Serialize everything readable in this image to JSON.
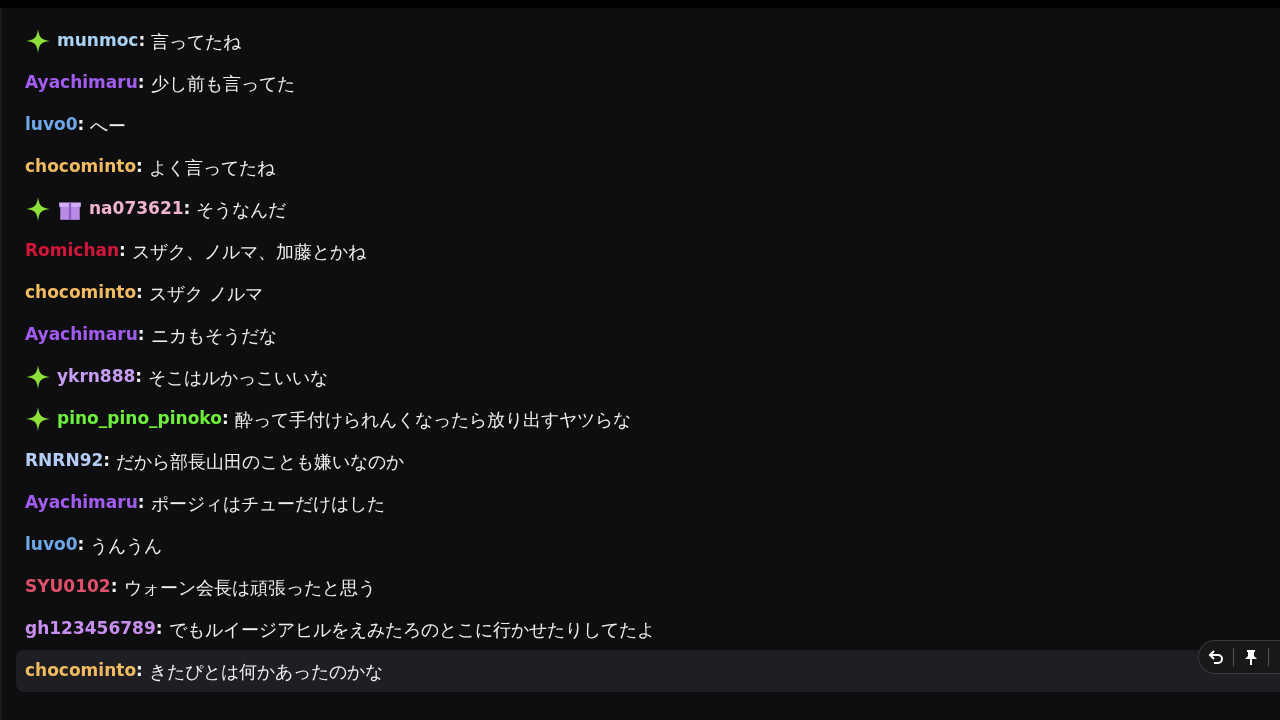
{
  "messages": [
    {
      "user": "munmoc",
      "separator": ":",
      "color": "#a9d2f5",
      "badges": [
        {
          "kind": "sparkle"
        }
      ],
      "text": "言ってたね",
      "hovered": false
    },
    {
      "user": "Ayachimaru",
      "separator": ":",
      "color": "#a25cf0",
      "text": "少し前も言ってた",
      "hovered": false
    },
    {
      "user": "luvo0",
      "separator": ":",
      "color": "#6fa8e8",
      "text": "へー",
      "hovered": false
    },
    {
      "user": "chocominto",
      "separator": ":",
      "color": "#f1bb62",
      "text": "よく言ってたね",
      "hovered": false
    },
    {
      "user": "na073621",
      "separator": ":",
      "color": "#f0b4cf",
      "badges": [
        {
          "kind": "sparkle"
        },
        {
          "kind": "gift"
        }
      ],
      "text": "そうなんだ",
      "hovered": false
    },
    {
      "user": "Romichan",
      "separator": ":",
      "color": "#d2153a",
      "text": "スザク、ノルマ、加藤とかね",
      "hovered": false
    },
    {
      "user": "chocominto",
      "separator": ":",
      "color": "#f1bb62",
      "text": "スザク ノルマ",
      "hovered": false
    },
    {
      "user": "Ayachimaru",
      "separator": ":",
      "color": "#a25cf0",
      "text": "ニカもそうだな",
      "hovered": false
    },
    {
      "user": "ykrn888",
      "separator": ":",
      "color": "#c69df2",
      "badges": [
        {
          "kind": "sparkle"
        }
      ],
      "text": "そこはルかっこいいな",
      "hovered": false
    },
    {
      "user": "pino_pino_pinoko",
      "separator": ":",
      "color": "#6df03c",
      "badges": [
        {
          "kind": "sparkle"
        }
      ],
      "text": "酔って手付けられんくなったら放り出すヤツらな",
      "hovered": false
    },
    {
      "user": "RNRN92",
      "separator": ":",
      "color": "#b5cdf5",
      "text": "だから部長山田のことも嫌いなのか",
      "hovered": false
    },
    {
      "user": "Ayachimaru",
      "separator": ":",
      "color": "#a25cf0",
      "text": "ポージィはチューだけはした",
      "hovered": false
    },
    {
      "user": "luvo0",
      "separator": ":",
      "color": "#6fa8e8",
      "text": "うんうん",
      "hovered": false
    },
    {
      "user": "SYU0102",
      "separator": ":",
      "color": "#e0506b",
      "text": "ウォーン会長は頑張ったと思う",
      "hovered": false
    },
    {
      "user": "gh123456789",
      "separator": ":",
      "color": "#c98ff0",
      "text": "でもルイージアヒルをえみたろのとこに行かせたりしてたよ",
      "hovered": false
    },
    {
      "user": "chocominto",
      "separator": ":",
      "color": "#f1bb62",
      "text": "きたぴとは何かあったのかな",
      "hovered": true
    }
  ]
}
